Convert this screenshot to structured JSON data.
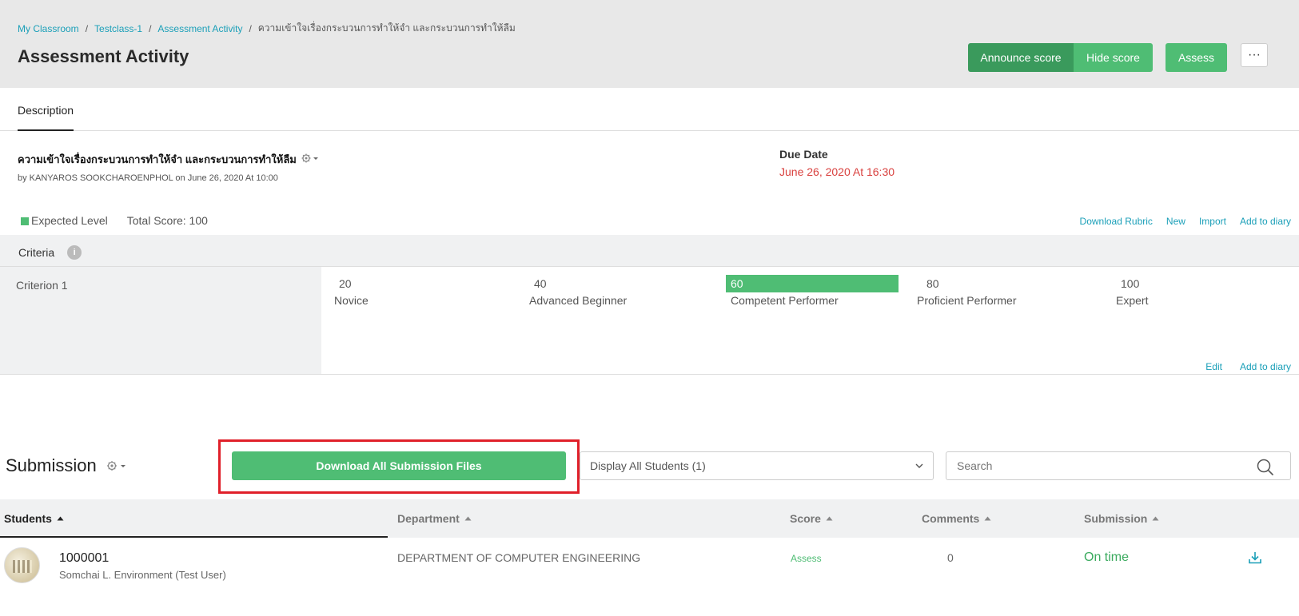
{
  "breadcrumb": {
    "items": [
      "My Classroom",
      "Testclass-1",
      "Assessment Activity"
    ],
    "current": "ความเข้าใจเรื่องกระบวนการทำให้จำ และกระบวนการทำให้ลืม"
  },
  "header": {
    "title": "Assessment Activity",
    "announce_label": "Announce score",
    "hide_label": "Hide score",
    "assess_label": "Assess",
    "more_label": "···"
  },
  "tabs": {
    "description": "Description"
  },
  "activity": {
    "title": "ความเข้าใจเรื่องกระบวนการทำให้จำ และกระบวนการทำให้ลืม",
    "meta": "by KANYAROS SOOKCHAROENPHOL on June 26, 2020 At 10:00",
    "due_label": "Due Date",
    "due_value": "June 26, 2020 At 16:30"
  },
  "rubric": {
    "expected_level": "Expected Level",
    "total_score": "Total Score: 100",
    "links": [
      "Download Rubric",
      "New",
      "Import",
      "Add to diary"
    ],
    "criteria_label": "Criteria",
    "criterion_name": "Criterion 1",
    "levels": [
      {
        "score": "20",
        "name": "Novice"
      },
      {
        "score": "40",
        "name": "Advanced Beginner"
      },
      {
        "score": "60",
        "name": "Competent Performer"
      },
      {
        "score": "80",
        "name": "Proficient Performer"
      },
      {
        "score": "100",
        "name": "Expert"
      }
    ],
    "active_level_index": 2,
    "criterion_links": [
      "Edit",
      "Add to diary"
    ]
  },
  "submission": {
    "title": "Submission",
    "download_all_label": "Download All Submission Files",
    "filter_value": "Display All Students (1)",
    "search_placeholder": "Search",
    "columns": [
      "Students",
      "Department",
      "Score",
      "Comments",
      "Submission"
    ],
    "rows": [
      {
        "id": "1000001",
        "name": "Somchai L. Environment (Test User)",
        "department": "DEPARTMENT OF COMPUTER ENGINEERING",
        "score": "Assess",
        "comments": "0",
        "submission": "On time"
      }
    ]
  },
  "colors": {
    "green": "#4fbd74",
    "dark_green": "#3a9a5c",
    "link": "#1a9fb8",
    "due": "#d9413f",
    "highlight": "#e0202a"
  }
}
